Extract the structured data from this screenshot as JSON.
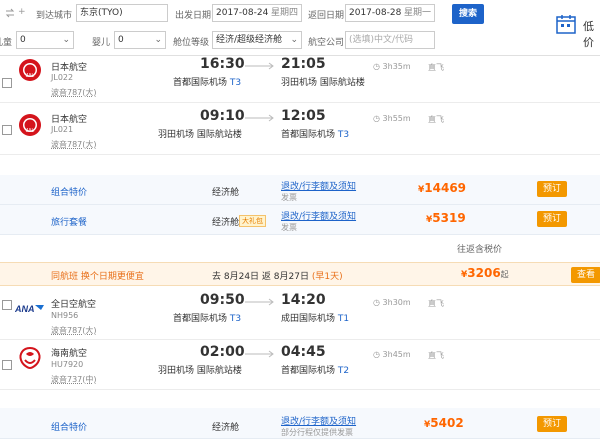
{
  "search": {
    "from_placeholder": "",
    "to_label": "到达城市",
    "to_value": "东京(TYO)",
    "depart_label": "出发日期",
    "depart_value": "2017-08-24",
    "depart_weekday": "星期四",
    "return_label": "返回日期",
    "return_value": "2017-08-28",
    "return_weekday": "星期一",
    "search_button": "搜索",
    "children_label": "儿童",
    "children_value": "0",
    "infant_label": "婴儿",
    "infant_value": "0",
    "cabin_label": "舱位等级",
    "cabin_value": "经济/超级经济舱",
    "airline_label": "航空公司",
    "airline_placeholder": "(选填)中文/代码",
    "lowest_price_label": "低价"
  },
  "flights": [
    {
      "airline": "日本航空",
      "flight_no": "JL022",
      "plane": "波音787(大)",
      "dep_time": "16:30",
      "dep_airport": "首都国际机场",
      "dep_term": "T3",
      "arr_time": "21:05",
      "arr_airport": "羽田机场 国际航站楼",
      "arr_term": "",
      "duration": "3h35m",
      "direct": "直飞"
    },
    {
      "airline": "日本航空",
      "flight_no": "JL021",
      "plane": "波音787(大)",
      "dep_time": "09:10",
      "dep_airport": "羽田机场 国际航站楼",
      "dep_term": "",
      "arr_time": "12:05",
      "arr_airport": "首都国际机场",
      "arr_term": "T3",
      "duration": "3h55m",
      "direct": "直飞"
    }
  ],
  "price_options_1": [
    {
      "name": "组合特价",
      "cabin": "经济舱",
      "gift": "",
      "rules": "退改/行李额及须知",
      "rules_sub": "发票",
      "price": "14469",
      "book": "预订"
    },
    {
      "name": "旅行套餐",
      "cabin": "经济舱",
      "gift": "大礼包",
      "rules": "退改/行李额及须知",
      "rules_sub": "发票",
      "price": "5319",
      "book": "预订"
    }
  ],
  "tax_note": "往返含税价",
  "strip": {
    "left": "同航班 换个日期更便宜",
    "dates": "去 8月24日  返 8月27日",
    "earlier": "(早1天)",
    "price": "3206",
    "suffix": "起",
    "button": "查看"
  },
  "flights2": [
    {
      "airline": "全日空航空",
      "flight_no": "NH956",
      "plane": "波音787(大)",
      "dep_time": "09:50",
      "dep_airport": "首都国际机场",
      "dep_term": "T3",
      "arr_time": "14:20",
      "arr_airport": "成田国际机场",
      "arr_term": "T1",
      "duration": "3h30m",
      "direct": "直飞"
    },
    {
      "airline": "海南航空",
      "flight_no": "HU7920",
      "plane": "波音737(中)",
      "dep_time": "02:00",
      "dep_airport": "羽田机场 国际航站楼",
      "dep_term": "",
      "arr_time": "04:45",
      "arr_airport": "首都国际机场",
      "arr_term": "T2",
      "duration": "3h45m",
      "direct": "直飞"
    }
  ],
  "price_options_2": [
    {
      "name": "组合特价",
      "cabin": "经济舱",
      "rules": "退改/行李额及须知",
      "rules_sub": "部分行程仅提供发票",
      "price": "5402",
      "book": "预订"
    }
  ],
  "currency": "¥",
  "colors": {
    "accent_blue": "#1d63c9",
    "price_orange": "#ff6600",
    "book_orange": "#f39800"
  }
}
